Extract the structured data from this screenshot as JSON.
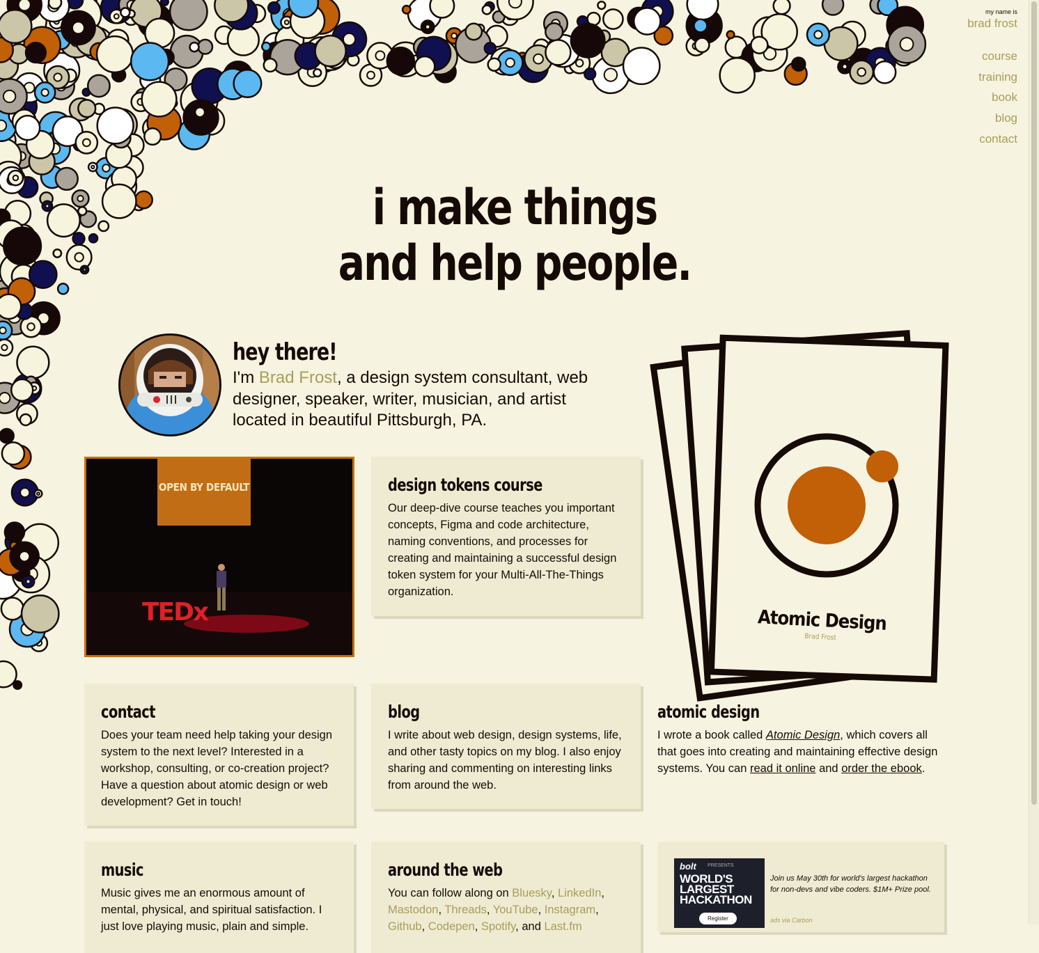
{
  "brand": {
    "tagline": "my name is",
    "name": "brad frost"
  },
  "nav": [
    "course",
    "training",
    "book",
    "blog",
    "contact"
  ],
  "hero": {
    "line1": "i make things",
    "line2": "and help people."
  },
  "intro": {
    "heading": "hey there!",
    "text_before": "I'm ",
    "name_link": "Brad Frost",
    "text_after": ", a design system consultant, web designer, speaker, writer, musician, and artist located in beautiful Pittsburgh, PA."
  },
  "ted_photo": {
    "screen_text": "OPEN BY DEFAULT",
    "stage_text": "TEDx"
  },
  "cards": {
    "design_tokens": {
      "title": "design tokens course",
      "body": "Our deep-dive course teaches you important concepts, Figma and code architecture, naming conventions, and processes for creating and maintaining a successful design token system for your Multi-All-The-Things organization."
    },
    "contact": {
      "title": "contact",
      "body": "Does your team need help taking your design system to the next level? Interested in a workshop, consulting, or co-creation project? Have a question about atomic design or web development? Get in touch!"
    },
    "blog": {
      "title": "blog",
      "body": "I write about web design, design systems, life, and other tasty topics on my blog. I also enjoy sharing and commenting on interesting links from around the web."
    },
    "atomic": {
      "title": "atomic design",
      "t1": "I wrote a book called ",
      "book_title": "Atomic Design",
      "t2": ", which covers all that goes into creating and maintaining effective design systems. You can ",
      "link1": "read it online",
      "t3": " and ",
      "link2": "order the ebook",
      "t4": "."
    },
    "music": {
      "title": "music",
      "body": "Music gives me an enormous amount of mental, physical, and spiritual satisfaction. I just love playing music, plain and simple."
    },
    "web": {
      "title": "around the web",
      "intro": "You can follow along on ",
      "links": [
        "Bluesky",
        "LinkedIn",
        "Mastodon",
        "Threads",
        "YouTube",
        "Instagram",
        "Github",
        "Codepen",
        "Spotify"
      ],
      "and": "and",
      "last": "Last.fm"
    }
  },
  "book": {
    "title": "Atomic Design",
    "author": "Brad Frost",
    "accent": "#c16006"
  },
  "ad": {
    "brand": "bolt",
    "presents": "PRESENTS",
    "headline": "WORLD'S LARGEST HACKATHON",
    "prize_badge": "$1M+",
    "button": "Register",
    "text": "Join us May 30th for world's largest hackathon for non-devs and vibe coders. $1M+ Prize pool.",
    "via": "ads via Carbon"
  },
  "colors": {
    "background": "#f6f4e0",
    "ink": "#150a05",
    "link": "#a89d5a",
    "card": "#efebd2",
    "orange": "#c16006",
    "sky": "#5bb8f0",
    "navy": "#101050",
    "gray": "#aaa49a"
  }
}
